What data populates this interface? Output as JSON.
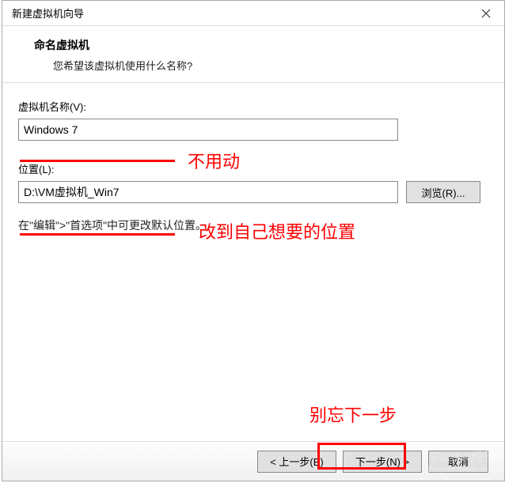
{
  "window": {
    "title": "新建虚拟机向导"
  },
  "header": {
    "heading": "命名虚拟机",
    "sub": "您希望该虚拟机使用什么名称?"
  },
  "fields": {
    "name_label": "虚拟机名称(V):",
    "name_value": "Windows 7",
    "location_label": "位置(L):",
    "location_value": "D:\\VM虚拟机_Win7",
    "browse_label": "浏览(R)...",
    "hint": "在\"编辑\">\"首选项\"中可更改默认位置。"
  },
  "annotations": {
    "dont_change": "不用动",
    "change_location": "改到自己想要的位置",
    "dont_forget_next": "别忘下一步"
  },
  "footer": {
    "back": "< 上一步(B)",
    "next": "下一步(N) >",
    "cancel": "取消"
  },
  "watermark": {
    "brand": "Baidu 经验",
    "url": "jingyan.baidu.com"
  }
}
